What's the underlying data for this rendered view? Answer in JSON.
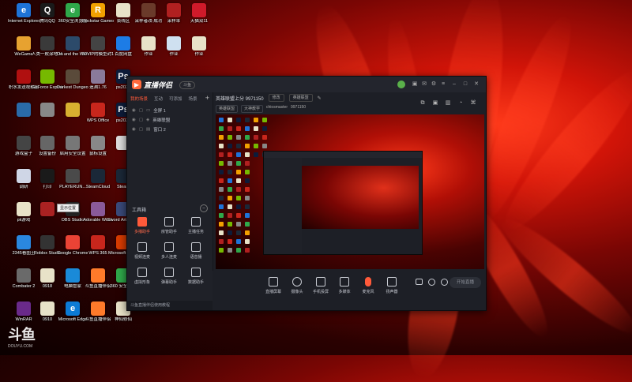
{
  "desktop": {
    "icons": [
      {
        "label": "Internet Explorer",
        "color": "#1e73d8",
        "glyph": "e"
      },
      {
        "label": "腾讯QQ",
        "color": "#1a1a1a",
        "glyph": "Q"
      },
      {
        "label": "360安全浏览器",
        "color": "#2fa84a",
        "glyph": "e"
      },
      {
        "label": "Rockstar Games...",
        "color": "#f2a100",
        "glyph": "R"
      },
      {
        "label": "菜线区",
        "color": "#e8e2c8",
        "glyph": ""
      },
      {
        "label": "采样者改-成功",
        "color": "#6a3a2a",
        "glyph": ""
      },
      {
        "label": "采样率",
        "color": "#b02020",
        "glyph": ""
      },
      {
        "label": "天猫双11",
        "color": "#d01a2a",
        "glyph": ""
      },
      {
        "label": "WeGame",
        "color": "#e7a230",
        "glyph": ""
      },
      {
        "label": "人类一败涂地 Human Fa...",
        "color": "#3a3a3a",
        "glyph": ""
      },
      {
        "label": "Ori and the Will of th...",
        "color": "#2c4a6a",
        "glyph": ""
      },
      {
        "label": "50VIP的模型封1.76",
        "color": "#444",
        "glyph": ""
      },
      {
        "label": "百度网盘",
        "color": "#1d7ce6",
        "glyph": ""
      },
      {
        "label": "作业",
        "color": "#e8e2c8",
        "glyph": ""
      },
      {
        "label": "作业",
        "color": "#cfe0f0",
        "glyph": ""
      },
      {
        "label": "作业",
        "color": "#e8e2c8",
        "glyph": ""
      },
      {
        "label": "积水发送视频服",
        "color": "#b01010",
        "glyph": ""
      },
      {
        "label": "GeForce Experience",
        "color": "#76b900",
        "glyph": ""
      },
      {
        "label": "Darkest Dungeon",
        "color": "#5a4a3a",
        "glyph": ""
      },
      {
        "label": "追溯1.76",
        "color": "#8a7a9a",
        "glyph": ""
      },
      {
        "label": "ps2020",
        "color": "#0d1c3a",
        "glyph": "Ps"
      },
      {
        "label": "",
        "color": "#2a6aa8",
        "glyph": ""
      },
      {
        "label": "",
        "color": "#888",
        "glyph": ""
      },
      {
        "label": "",
        "color": "#d8b030",
        "glyph": ""
      },
      {
        "label": "WPS Office",
        "color": "#c8261c",
        "glyph": ""
      },
      {
        "label": "ps2020",
        "color": "#0d1c3a",
        "glyph": "Ps"
      },
      {
        "label": "游戏盒子",
        "color": "#444",
        "glyph": ""
      },
      {
        "label": "设置备份",
        "color": "#666",
        "glyph": ""
      },
      {
        "label": "启用安全设置",
        "color": "#777",
        "glyph": ""
      },
      {
        "label": "鼠标设置",
        "color": "#888",
        "glyph": ""
      },
      {
        "label": "",
        "color": "#ddd",
        "glyph": ""
      },
      {
        "label": "调研",
        "color": "#cfd6e6",
        "glyph": ""
      },
      {
        "label": "打印",
        "color": "#1a1a1a",
        "glyph": ""
      },
      {
        "label": "PLAYERUN...",
        "color": "#4a4a4a",
        "glyph": ""
      },
      {
        "label": "SteamCloud",
        "color": "#1b2838",
        "glyph": ""
      },
      {
        "label": "Steam",
        "color": "#1b2838",
        "glyph": ""
      },
      {
        "label": "永劫无间",
        "color": "#7a1a1a",
        "glyph": ""
      },
      {
        "label": "pk游戏",
        "color": "#e8e2c8",
        "glyph": ""
      },
      {
        "label": "",
        "color": "#aa2222",
        "glyph": ""
      },
      {
        "label": "OBS Studio",
        "color": "#222",
        "glyph": ""
      },
      {
        "label": "Adorable Witch",
        "color": "#8a5a9a",
        "glyph": ""
      },
      {
        "label": "Sword Art Online Fat...",
        "color": "#3a4a7a",
        "glyph": ""
      },
      {
        "label": "2345看图王",
        "color": "#2a88e0",
        "glyph": ""
      },
      {
        "label": "Roblox Studio",
        "color": "#333",
        "glyph": ""
      },
      {
        "label": "Google Chrome",
        "color": "#ea4335",
        "glyph": ""
      },
      {
        "label": "WPS 365",
        "color": "#c8261c",
        "glyph": ""
      },
      {
        "label": "Microsoft Office",
        "color": "#d83b01",
        "glyph": ""
      },
      {
        "label": "Combater 2",
        "color": "#6a6a6a",
        "glyph": ""
      },
      {
        "label": "0918",
        "color": "#e8e2c8",
        "glyph": ""
      },
      {
        "label": "电脑管家",
        "color": "#1a8ad8",
        "glyph": ""
      },
      {
        "label": "斗鱼直播伴侣",
        "color": "#ff7a2a",
        "glyph": ""
      },
      {
        "label": "360 安全卫士",
        "color": "#2fa84a",
        "glyph": ""
      },
      {
        "label": "WinRAR",
        "color": "#6a2a8a",
        "glyph": ""
      },
      {
        "label": "0910",
        "color": "#e8e2c8",
        "glyph": ""
      },
      {
        "label": "Microsoft Edge",
        "color": "#0c7bd6",
        "glyph": "e"
      },
      {
        "label": "斗鱼直播伴侣",
        "color": "#ff7a2a",
        "glyph": ""
      },
      {
        "label": "神仙修仙",
        "color": "#e8e2c8",
        "glyph": ""
      },
      {
        "label": "网易云音乐",
        "color": "#e21a1a",
        "glyph": ""
      },
      {
        "label": "9227FB新",
        "color": "#3a6ab8",
        "glyph": ""
      },
      {
        "label": "毛概",
        "color": "#c8261c",
        "glyph": "PDF"
      }
    ],
    "watermark": "斗鱼",
    "watermark_sub": "DOUYU.COM",
    "tooltip": "显示位置"
  },
  "app": {
    "name": "直播伴侣",
    "version_badge": "斗鱼",
    "tabs": [
      "我的场景",
      "互动",
      "可添加",
      "场景"
    ],
    "scenes": [
      "全屏 1",
      "英雄联盟",
      "窗口 2"
    ],
    "tools_header": "工具箱",
    "tools": [
      {
        "label": "多播助手",
        "hot": true
      },
      {
        "label": "房管助手",
        "hot": false
      },
      {
        "label": "主播任务",
        "hot": false
      },
      {
        "label": "视频连麦",
        "hot": false
      },
      {
        "label": "多人连麦",
        "hot": false
      },
      {
        "label": "语音播",
        "hot": false
      },
      {
        "label": "虚拟形象",
        "hot": false
      },
      {
        "label": "弹幕助手",
        "hot": false
      },
      {
        "label": "数据助手",
        "hot": false
      }
    ],
    "status_text": "斗鱼直播伴侣使用教程",
    "room": {
      "title": "英雄联盟上分 9971150",
      "edit": "修改",
      "category": "英雄联盟",
      "tags": [
        "英雄联盟",
        "大神教学"
      ],
      "streamer": "chiosmaster",
      "room_id": "9971150"
    },
    "bottom_buttons": [
      "直播屏幕",
      "摄像头",
      "手机投屏",
      "多媒体",
      "麦克风",
      "扬声器"
    ],
    "start_button": "开始直播"
  }
}
